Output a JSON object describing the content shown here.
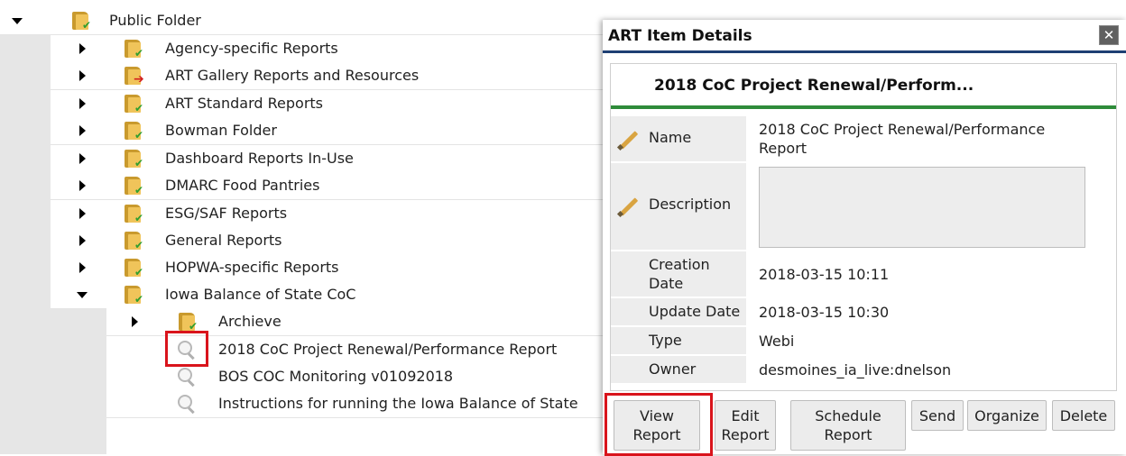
{
  "tree": {
    "root": {
      "label": "Public Folder"
    },
    "folders": [
      {
        "label": "Agency-specific Reports",
        "badge": "check"
      },
      {
        "label": "ART Gallery Reports and Resources",
        "badge": "arrow"
      },
      {
        "label": "ART Standard Reports",
        "badge": "check"
      },
      {
        "label": "Bowman Folder",
        "badge": "check"
      },
      {
        "label": "Dashboard Reports In-Use",
        "badge": "check"
      },
      {
        "label": "DMARC Food Pantries",
        "badge": "check"
      },
      {
        "label": "ESG/SAF Reports",
        "badge": "check"
      },
      {
        "label": "General Reports",
        "badge": "check"
      },
      {
        "label": "HOPWA-specific Reports",
        "badge": "check"
      },
      {
        "label": "Iowa Balance of State CoC",
        "badge": "check"
      }
    ],
    "subfolder": {
      "label": "Archieve"
    },
    "reports": [
      {
        "label": "2018 CoC Project Renewal/Performance Report",
        "selected": true
      },
      {
        "label": "BOS COC Monitoring v01092018"
      },
      {
        "label": "Instructions for running the Iowa Balance of State"
      }
    ]
  },
  "dialog": {
    "title": "ART Item Details",
    "close_glyph": "✕",
    "card_title": "2018 CoC Project Renewal/Perform...",
    "properties": {
      "name_label": "Name",
      "name_value_line1": "2018 CoC Project Renewal/Performance",
      "name_value_line2": "Report",
      "description_label": "Description",
      "description_value": "",
      "creation_label_line1": "Creation",
      "creation_label_line2": "Date",
      "creation_value": "2018-03-15 10:11",
      "update_label": "Update Date",
      "update_value": "2018-03-15 10:30",
      "type_label": "Type",
      "type_value": "Webi",
      "owner_label": "Owner",
      "owner_value": "desmoines_ia_live:dnelson"
    },
    "buttons": {
      "view_line1": "View",
      "view_line2": "Report",
      "edit_line1": "Edit",
      "edit_line2": "Report",
      "schedule_line1": "Schedule",
      "schedule_line2": "Report",
      "send": "Send",
      "organize": "Organize",
      "delete": "Delete"
    }
  },
  "colors": {
    "highlight": "#d9141c",
    "header_rule": "#1e3f73",
    "card_rule": "#2e8b3a"
  }
}
